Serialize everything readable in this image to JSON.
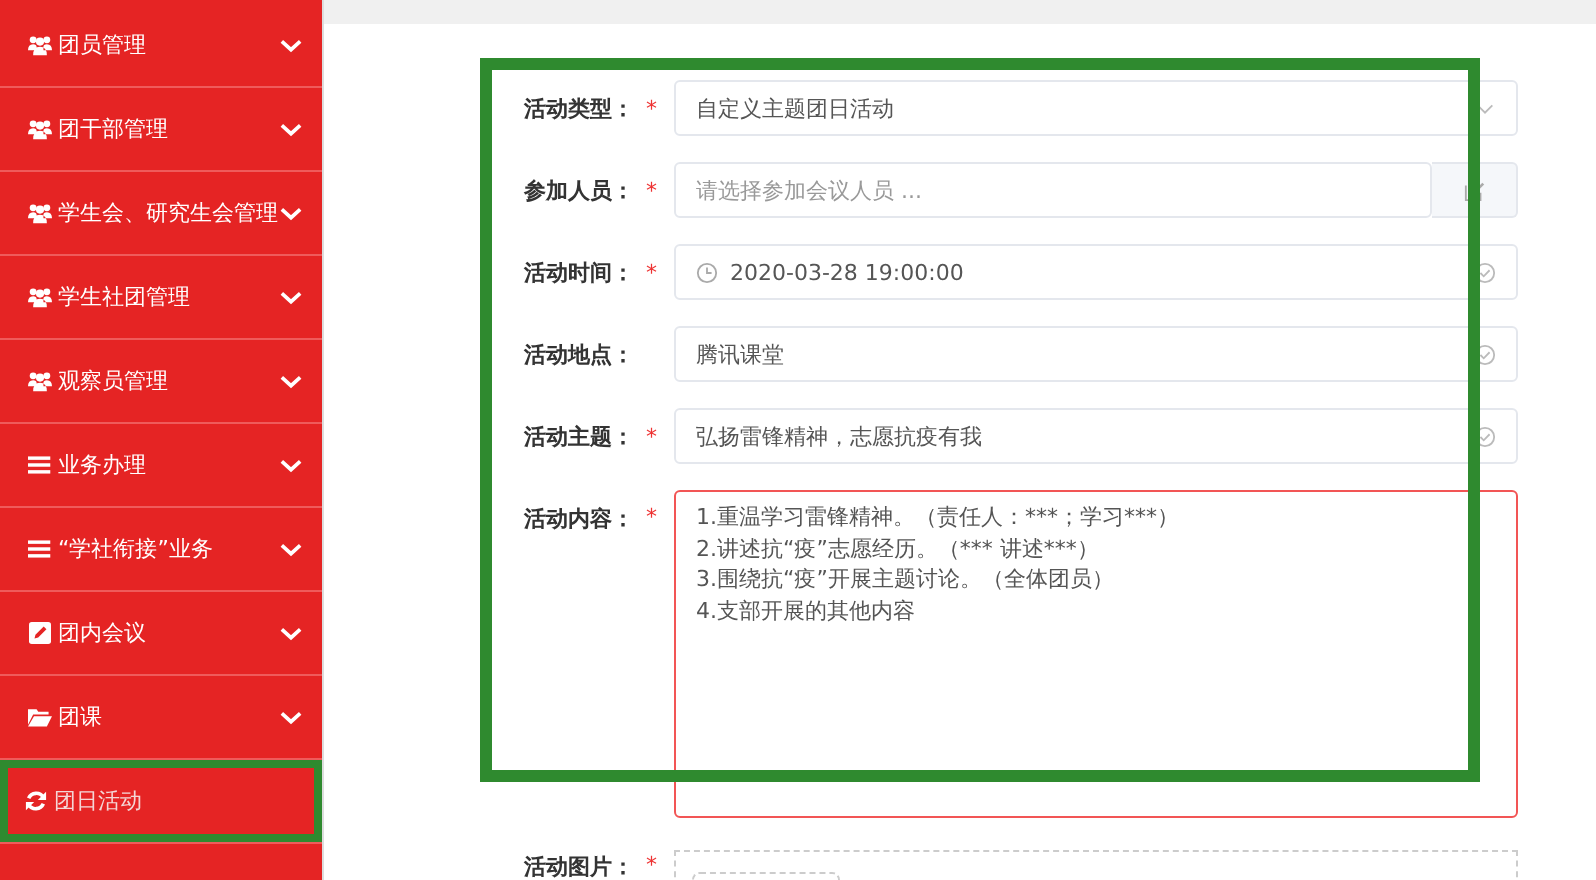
{
  "sidebar": {
    "items": [
      {
        "label": "团员管理",
        "kind": "people",
        "expandable": true,
        "selected": false,
        "highlighted": false
      },
      {
        "label": "团干部管理",
        "kind": "people",
        "expandable": true,
        "selected": false,
        "highlighted": false
      },
      {
        "label": "学生会、研究生会管理",
        "kind": "people",
        "expandable": true,
        "selected": false,
        "highlighted": false
      },
      {
        "label": "学生社团管理",
        "kind": "people",
        "expandable": true,
        "selected": false,
        "highlighted": false
      },
      {
        "label": "观察员管理",
        "kind": "people",
        "expandable": true,
        "selected": false,
        "highlighted": false
      },
      {
        "label": "业务办理",
        "kind": "business",
        "expandable": true,
        "selected": false,
        "highlighted": false
      },
      {
        "label": "“学社衔接”业务",
        "kind": "business",
        "expandable": true,
        "selected": false,
        "highlighted": false
      },
      {
        "label": "团内会议",
        "kind": "meeting",
        "expandable": true,
        "selected": false,
        "highlighted": false
      },
      {
        "label": "团课",
        "kind": "course",
        "expandable": true,
        "selected": false,
        "highlighted": false
      },
      {
        "label": "团日活动",
        "kind": "activity",
        "expandable": false,
        "selected": true,
        "highlighted": true
      }
    ]
  },
  "form": {
    "highlighted": true,
    "fields": [
      {
        "label": "活动类型：",
        "marker": "*",
        "kind": "select",
        "value": "自定义主题团日活动",
        "valid": false,
        "invalid": false
      },
      {
        "label": "参加人员：",
        "marker": "*",
        "kind": "picker",
        "placeholder": "请选择参加会议人员 ...",
        "valid": false,
        "invalid": false
      },
      {
        "label": "活动时间：",
        "marker": "*",
        "kind": "datetime",
        "value": "2020-03-28 19:00:00",
        "valid": true,
        "invalid": false
      },
      {
        "label": "活动地点：",
        "kind": "text",
        "value": "腾讯课堂",
        "valid": true,
        "invalid": false
      },
      {
        "label": "活动主题：",
        "marker": "*",
        "kind": "text",
        "value": "弘扬雷锋精神，志愿抗疫有我",
        "valid": true,
        "invalid": false
      },
      {
        "label": "活动内容：",
        "marker": "*",
        "kind": "textarea",
        "lines": [
          "1.重温学习雷锋精神。（责任人：***；学习***）",
          "2.讲述抗“疫”志愿经历。（*** 讲述***）",
          "3.围绕抗“疫”开展主题讨论。（全体团员）",
          "4.支部开展的其他内容"
        ],
        "valid": false,
        "invalid": true
      },
      {
        "label": "活动图片：",
        "marker": "*",
        "kind": "upload",
        "valid": false,
        "invalid": false
      }
    ]
  }
}
